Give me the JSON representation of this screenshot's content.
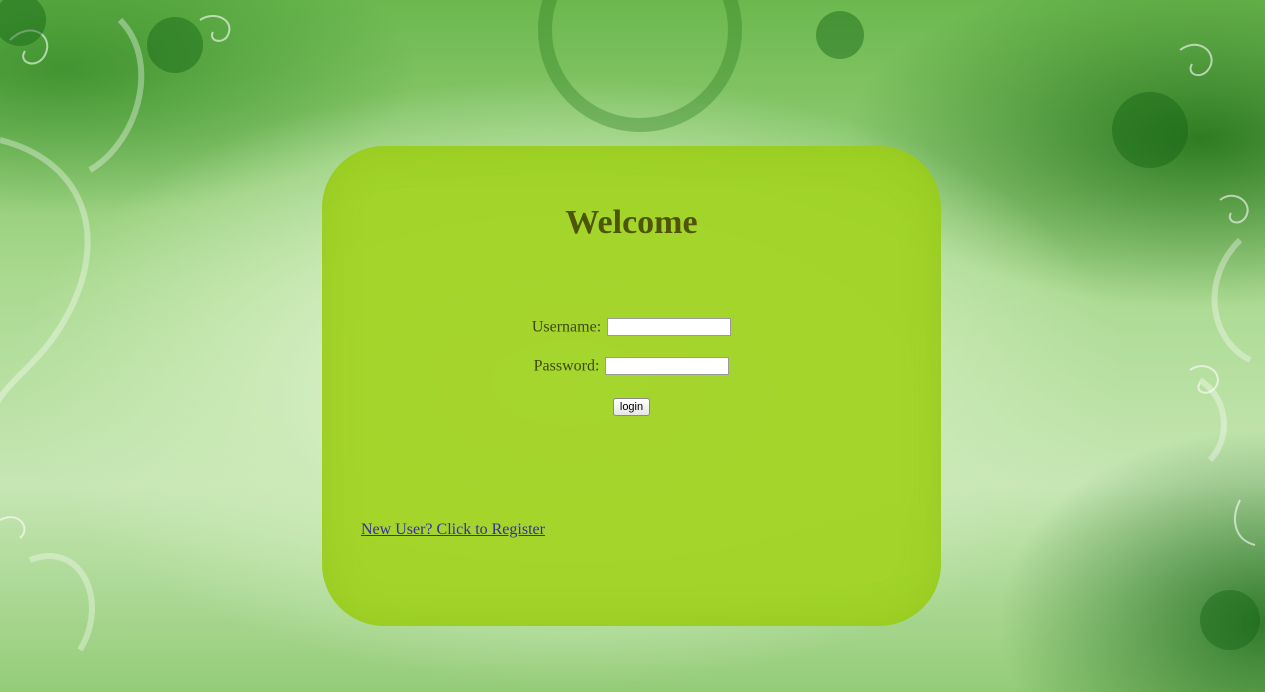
{
  "page": {
    "title": "Welcome"
  },
  "login_form": {
    "username_label": "Username:",
    "username_value": "",
    "password_label": "Password:",
    "password_value": "",
    "login_button_label": "login"
  },
  "links": {
    "register_label": "New User? Click to Register"
  },
  "colors": {
    "card_background": "#a3d21e",
    "title_color": "#4f5508",
    "link_color": "#3a2ca0",
    "page_background": "#b5dd9f"
  },
  "background": {
    "decoration_icon": "floral-swirl-pattern"
  }
}
